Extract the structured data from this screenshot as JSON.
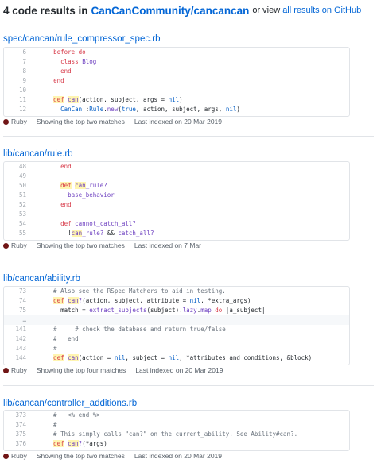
{
  "header": {
    "count_text": "4 code results in",
    "repo": "CanCanCommunity/cancancan",
    "or_text": "or view",
    "all_link": "all results on GitHub"
  },
  "results": [
    {
      "path": "spec/cancan/rule_compressor_spec.rb",
      "lang": "Ruby",
      "summary": "Showing the top two matches",
      "indexed": "Last indexed on 20 Mar 2019",
      "lines": [
        {
          "n": "6",
          "c": "    before do"
        },
        {
          "n": "7",
          "c": "      class Blog"
        },
        {
          "n": "8",
          "c": "      end"
        },
        {
          "n": "9",
          "c": "    end"
        },
        {
          "n": "10",
          "c": ""
        },
        {
          "n": "11",
          "c": "    def can(action, subject, args = nil)"
        },
        {
          "n": "12",
          "c": "      CanCan::Rule.new(true, action, subject, args, nil)"
        }
      ]
    },
    {
      "path": "lib/cancan/rule.rb",
      "lang": "Ruby",
      "summary": "Showing the top two matches",
      "indexed": "Last indexed on 7 Mar",
      "lines": [
        {
          "n": "48",
          "c": "      end"
        },
        {
          "n": "49",
          "c": ""
        },
        {
          "n": "50",
          "c": "      def can_rule?"
        },
        {
          "n": "51",
          "c": "        base_behavior"
        },
        {
          "n": "52",
          "c": "      end"
        },
        {
          "n": "53",
          "c": ""
        },
        {
          "n": "54",
          "c": "      def cannot_catch_all?"
        },
        {
          "n": "55",
          "c": "        !can_rule? && catch_all?"
        }
      ]
    },
    {
      "path": "lib/cancan/ability.rb",
      "lang": "Ruby",
      "summary": "Showing the top four matches",
      "indexed": "Last indexed on 20 Mar 2019",
      "lines": [
        {
          "n": "73",
          "c": "    # Also see the RSpec Matchers to aid in testing."
        },
        {
          "n": "74",
          "c": "    def can?(action, subject, attribute = nil, *extra_args)"
        },
        {
          "n": "75",
          "c": "      match = extract_subjects(subject).lazy.map do |a_subject|"
        },
        {
          "n": "…",
          "c": ""
        },
        {
          "n": "141",
          "c": "    #     # check the database and return true/false"
        },
        {
          "n": "142",
          "c": "    #   end"
        },
        {
          "n": "143",
          "c": "    #"
        },
        {
          "n": "144",
          "c": "    def can(action = nil, subject = nil, *attributes_and_conditions, &block)"
        }
      ]
    },
    {
      "path": "lib/cancan/controller_additions.rb",
      "lang": "Ruby",
      "summary": "Showing the top two matches",
      "indexed": "Last indexed on 20 Mar 2019",
      "lines": [
        {
          "n": "373",
          "c": "    #   <% end %>"
        },
        {
          "n": "374",
          "c": "    #"
        },
        {
          "n": "375",
          "c": "    # This simply calls \"can?\" on the current_ability. See Ability#can?."
        },
        {
          "n": "376",
          "c": "    def can?(*args)"
        }
      ]
    }
  ]
}
